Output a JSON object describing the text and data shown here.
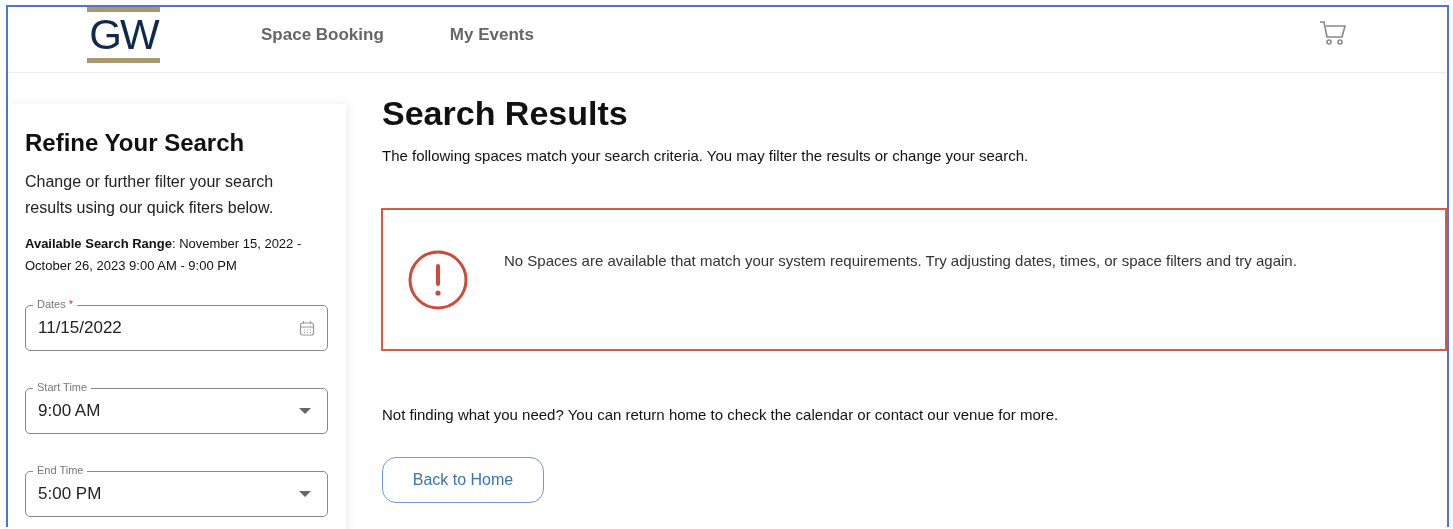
{
  "header": {
    "logo": "GW",
    "nav": [
      {
        "label": "Space Booking"
      },
      {
        "label": "My Events"
      }
    ]
  },
  "sidebar": {
    "title": "Refine Your Search",
    "intro": "Change or further filter your search results using our quick fiters below.",
    "range": "**Available Search Range**: November 15, 2022 - October 26, 2023 9:00 AM - 9:00 PM",
    "fields": [
      {
        "kind": "date",
        "label": "Dates",
        "required_mark": "*",
        "value": "11/15/2022"
      },
      {
        "kind": "select",
        "label": "Start Time",
        "value": "9:00 AM"
      },
      {
        "kind": "select",
        "label": "End Time",
        "value": "5:00 PM"
      }
    ]
  },
  "results": {
    "title": "Search Results",
    "subtitle": "The following spaces match your search criteria. You may filter the results or change your search.",
    "alert": "No Spaces are available that match your system requirements. Try adjusting dates, times, or space filters and try again.",
    "help": "Not finding what you need? You can return home to check the calendar or contact our venue for more.",
    "button": "Back to Home"
  }
}
